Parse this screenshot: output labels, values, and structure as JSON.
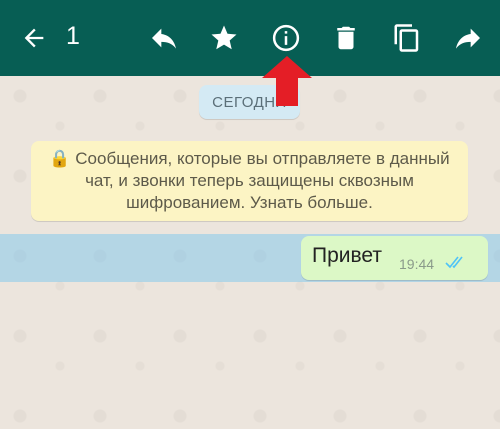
{
  "toolbar": {
    "selected_count": "1",
    "icons": [
      "back-arrow-icon",
      "reply-icon",
      "star-icon",
      "info-icon",
      "delete-icon",
      "copy-icon",
      "forward-icon"
    ],
    "background_color": "#075e54"
  },
  "chat": {
    "date_chip": "СЕГОДНЯ",
    "encryption_notice": "🔒 Сообщения, которые вы отправляете в данный чат, и звонки теперь защищены сквозным шифрованием. Узнать больше.",
    "messages": [
      {
        "text": "Привет",
        "time": "19:44",
        "status": "read",
        "selected": true
      }
    ]
  },
  "colors": {
    "outgoing_bubble": "#dcf8c6",
    "notice_bg": "#fcf4c4",
    "selection": "#72c4f0",
    "annotation_arrow": "#e41e26"
  }
}
